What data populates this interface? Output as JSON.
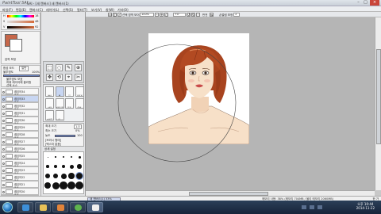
{
  "window": {
    "app_name": "PaintTool SAI",
    "title": "SAI - [새 캔버스] 새 캔버스(1)",
    "minimize": "–",
    "maximize": "□",
    "close": "×"
  },
  "menu": [
    "파일(F)",
    "편집(E)",
    "캔버스(C)",
    "레이어(L)",
    "선택(S)",
    "필터(T)",
    "보기(V)",
    "창(W)",
    "기타(O)"
  ],
  "toolbar": {
    "select_source": "선택 영역 보이기",
    "zoom": "100%",
    "angle": "+0°",
    "flip_label": "반전",
    "stabilizer_label": "손떨림 보정",
    "stabilizer_value": "3"
  },
  "color_panel": {
    "hsv_h": "H",
    "hsv_s": "S",
    "hsv_v": "V",
    "h_val": "18",
    "s_val": "48",
    "v_val": "92"
  },
  "layer_panel": {
    "pen_pressure": "압력 보정",
    "mode_label": "합성 모드",
    "mode_value": "일반",
    "opacity_label": "불투명도",
    "opacity_value": "100%",
    "protect_alpha": "불투명도 보호",
    "clipping": "하위 레이어에 클리핑",
    "select_source": "선택 소스",
    "layers": [
      {
        "name": "레이어34",
        "mode": "표준"
      },
      {
        "name": "레이어33",
        "mode": "표준"
      },
      {
        "name": "레이어32",
        "mode": "표준"
      },
      {
        "name": "레이어31",
        "mode": "표준"
      },
      {
        "name": "레이어30",
        "mode": "표준"
      },
      {
        "name": "레이어29",
        "mode": "표준"
      },
      {
        "name": "레이어28",
        "mode": "표준"
      },
      {
        "name": "레이어27",
        "mode": "표준"
      },
      {
        "name": "레이어26",
        "mode": "표준"
      },
      {
        "name": "레이어25",
        "mode": "표준"
      },
      {
        "name": "레이어24",
        "mode": "표준"
      },
      {
        "name": "레이어23",
        "mode": "표준"
      },
      {
        "name": "레이어22",
        "mode": "표준"
      },
      {
        "name": "레이어21",
        "mode": "표준"
      },
      {
        "name": "레이어20",
        "mode": "표준"
      },
      {
        "name": "레이어19",
        "mode": "표준"
      },
      {
        "name": "레이어18",
        "mode": "표준"
      }
    ]
  },
  "tool_panel": {
    "tools": [
      "에어",
      "펜",
      "붓",
      "지우개",
      "선택",
      "선택지우개",
      "물통",
      "연필",
      "수채붓",
      "브러시"
    ],
    "size_label": "최대 크기",
    "size_value": "1.0",
    "min_size_label": "최소 크기",
    "min_size_value": "0%",
    "density_label": "농도",
    "density_value": "100",
    "blend_label": "혼색",
    "shape_label": "[브러시 형태]",
    "texture_label": "[텍스처 없음]",
    "detail_label": "상세 설정"
  },
  "status": {
    "doc_tab": "새 캔버스(1)",
    "doc_zoom": "33%",
    "memory": "메모리 사용: 38% (메모리 704MB / 물리 메모리 2060MB)",
    "ime": "한 가"
  },
  "taskbar": {
    "time": "오후 10:44",
    "date": "2014-11-22"
  },
  "colors": {
    "hair": "#a8441f",
    "skin": "#f7e0c8",
    "lips": "#c94b4b",
    "selected_layer": "#c8d6f2",
    "taskbar": "#1f2f48"
  }
}
